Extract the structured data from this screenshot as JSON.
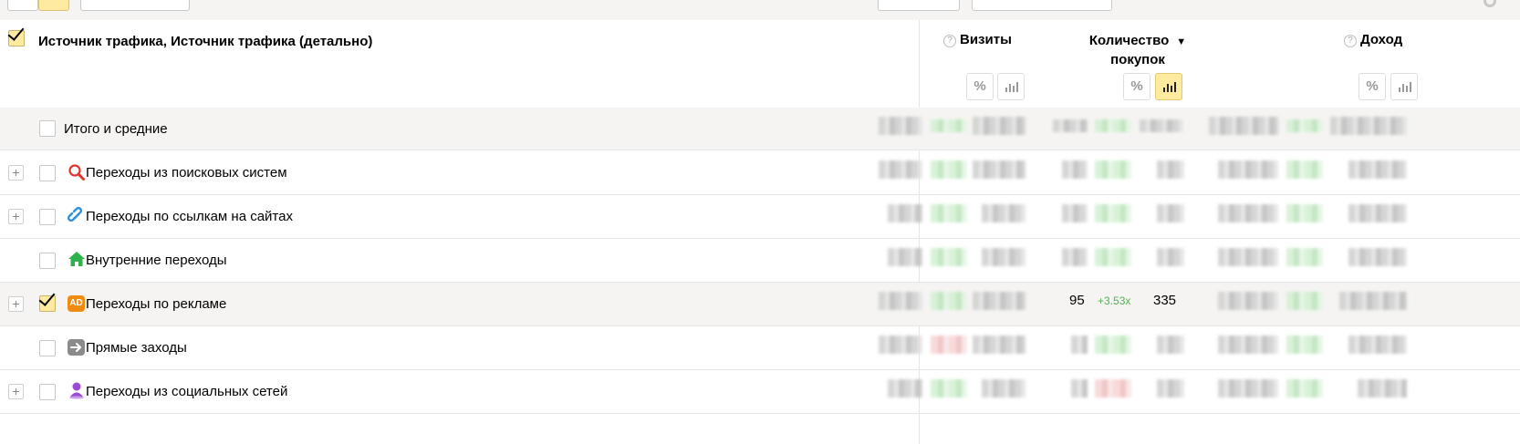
{
  "header": {
    "dimension_title": "Источник трафика, Источник трафика (детально)",
    "columns": [
      {
        "label": "Визиты",
        "help_icon": "question-icon"
      },
      {
        "label_line1": "Количество",
        "label_line2": "покупок",
        "sort": "▼"
      },
      {
        "label": "Доход",
        "help_icon": "question-icon"
      }
    ],
    "percent_symbol": "%",
    "question_symbol": "?"
  },
  "rows": [
    {
      "label": "Итого и средние",
      "expandable": false,
      "checked": false,
      "icon": null
    },
    {
      "label": "Переходы из поисковых систем",
      "expandable": true,
      "checked": false,
      "icon": "search-icon"
    },
    {
      "label": "Переходы по ссылкам на сайтах",
      "expandable": true,
      "checked": false,
      "icon": "link-icon"
    },
    {
      "label": "Внутренние переходы",
      "expandable": false,
      "checked": false,
      "icon": "home-icon"
    },
    {
      "label": "Переходы по рекламе",
      "expandable": true,
      "checked": true,
      "icon": "ad-icon",
      "ad_text": "AD",
      "purchases": "95",
      "purchases_delta": "+3.53x",
      "purchases_total": "335"
    },
    {
      "label": "Прямые заходы",
      "expandable": false,
      "checked": false,
      "icon": "arrow-right-icon"
    },
    {
      "label": "Переходы из социальных сетей",
      "expandable": true,
      "checked": false,
      "icon": "social-user-icon"
    }
  ],
  "expander_symbol": "+",
  "colors": {
    "accent_yellow": "#ffeba0",
    "positive_green": "#53b253",
    "row_grey": "#f5f4f2"
  }
}
